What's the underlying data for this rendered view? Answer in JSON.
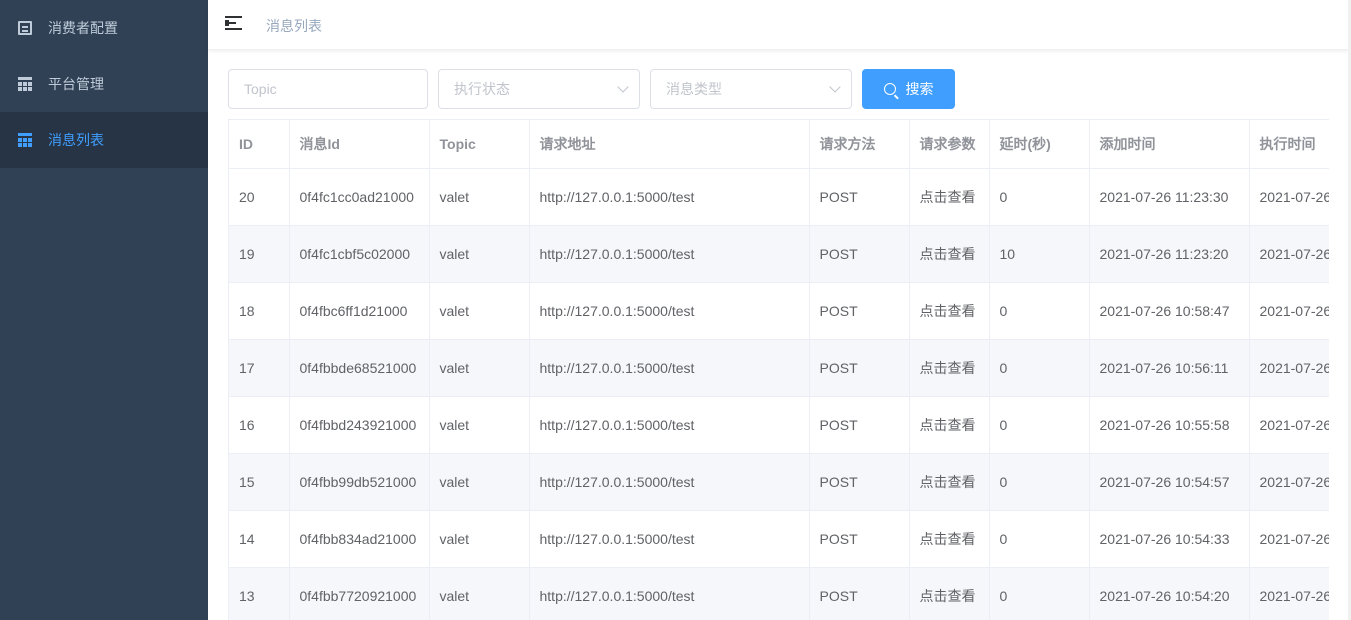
{
  "sidebar": {
    "items": [
      {
        "label": "消费者配置",
        "icon": "document-icon"
      },
      {
        "label": "平台管理",
        "icon": "grid-icon"
      },
      {
        "label": "消息列表",
        "icon": "grid-icon",
        "active": true
      }
    ]
  },
  "navbar": {
    "breadcrumb": "消息列表"
  },
  "filters": {
    "topic_placeholder": "Topic",
    "status_placeholder": "执行状态",
    "type_placeholder": "消息类型",
    "search_label": "搜索"
  },
  "table": {
    "headers": [
      "ID",
      "消息Id",
      "Topic",
      "请求地址",
      "请求方法",
      "请求参数",
      "延时(秒)",
      "添加时间",
      "执行时间"
    ],
    "rows": [
      [
        "20",
        "0f4fc1cc0ad21000",
        "valet",
        "http://127.0.0.1:5000/test",
        "POST",
        "点击查看",
        "0",
        "2021-07-26 11:23:30",
        "2021-07-26"
      ],
      [
        "19",
        "0f4fc1cbf5c02000",
        "valet",
        "http://127.0.0.1:5000/test",
        "POST",
        "点击查看",
        "10",
        "2021-07-26 11:23:20",
        "2021-07-26"
      ],
      [
        "18",
        "0f4fbc6ff1d21000",
        "valet",
        "http://127.0.0.1:5000/test",
        "POST",
        "点击查看",
        "0",
        "2021-07-26 10:58:47",
        "2021-07-26"
      ],
      [
        "17",
        "0f4fbbde68521000",
        "valet",
        "http://127.0.0.1:5000/test",
        "POST",
        "点击查看",
        "0",
        "2021-07-26 10:56:11",
        "2021-07-26"
      ],
      [
        "16",
        "0f4fbbd243921000",
        "valet",
        "http://127.0.0.1:5000/test",
        "POST",
        "点击查看",
        "0",
        "2021-07-26 10:55:58",
        "2021-07-26"
      ],
      [
        "15",
        "0f4fbb99db521000",
        "valet",
        "http://127.0.0.1:5000/test",
        "POST",
        "点击查看",
        "0",
        "2021-07-26 10:54:57",
        "2021-07-26"
      ],
      [
        "14",
        "0f4fbb834ad21000",
        "valet",
        "http://127.0.0.1:5000/test",
        "POST",
        "点击查看",
        "0",
        "2021-07-26 10:54:33",
        "2021-07-26"
      ],
      [
        "13",
        "0f4fbb7720921000",
        "valet",
        "http://127.0.0.1:5000/test",
        "POST",
        "点击查看",
        "0",
        "2021-07-26 10:54:20",
        "2021-07-26"
      ]
    ]
  },
  "colors": {
    "sidebar_bg": "#304156",
    "sidebar_active_bg": "#263445",
    "accent": "#409eff"
  }
}
